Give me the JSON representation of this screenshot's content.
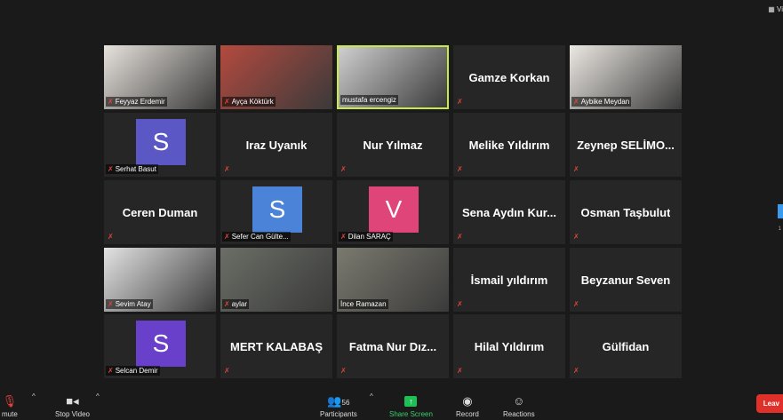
{
  "window": {
    "view_label": "Vi"
  },
  "tiles": [
    {
      "kind": "photo",
      "label": "Feyyaz Erdemir",
      "muted": true,
      "bg": "#2a2a2a",
      "photo_bg": "#e7e2dc"
    },
    {
      "kind": "photo",
      "label": "Ayça Köktürk",
      "muted": true,
      "bg": "#2a2a2a",
      "photo_bg": "#b44a3f"
    },
    {
      "kind": "photo",
      "label": "mustafa ercengiz",
      "muted": false,
      "active": true,
      "bg": "#2a2a2a",
      "photo_bg": "#cfcfcf"
    },
    {
      "kind": "name",
      "name": "Gamze Korkan",
      "muted": true
    },
    {
      "kind": "photo",
      "label": "Aybike Meydan",
      "muted": true,
      "bg": "#2a2a2a",
      "photo_bg": "#ece8e3"
    },
    {
      "kind": "avatar",
      "letter": "S",
      "label": "Serhat Basut",
      "muted": true,
      "color": "#5b57c5"
    },
    {
      "kind": "name",
      "name": "Iraz Uyanık",
      "muted": true
    },
    {
      "kind": "name",
      "name": "Nur Yılmaz",
      "muted": true
    },
    {
      "kind": "name",
      "name": "Melike Yıldırım",
      "muted": true
    },
    {
      "kind": "name",
      "name": "Zeynep SELİMO...",
      "muted": true
    },
    {
      "kind": "name",
      "name": "Ceren Duman",
      "muted": true
    },
    {
      "kind": "avatar",
      "letter": "S",
      "label": "Sefer Can Gülte...",
      "muted": true,
      "color": "#4a83d8"
    },
    {
      "kind": "avatar",
      "letter": "V",
      "label": "Dilan SARAÇ",
      "muted": true,
      "color": "#e0457a"
    },
    {
      "kind": "name",
      "name": "Sena Aydın Kur...",
      "muted": true
    },
    {
      "kind": "name",
      "name": "Osman Taşbulut",
      "muted": true
    },
    {
      "kind": "photo",
      "label": "Sevim Atay",
      "muted": true,
      "bg": "#2a2a2a",
      "photo_bg": "#e3e3e3"
    },
    {
      "kind": "photo",
      "label": "aylar",
      "muted": true,
      "bg": "#2a2a2a",
      "photo_bg": "#6b6e66"
    },
    {
      "kind": "photo",
      "label": "İnce Ramazan",
      "muted": false,
      "bg": "#2a2a2a",
      "photo_bg": "#7b7a6f"
    },
    {
      "kind": "name",
      "name": "İsmail yıldırım",
      "muted": true
    },
    {
      "kind": "name",
      "name": "Beyzanur Seven",
      "muted": true
    },
    {
      "kind": "avatar",
      "letter": "S",
      "label": "Selcan Demir",
      "muted": true,
      "color": "#6940c9"
    },
    {
      "kind": "name",
      "name": "MERT KALABAŞ",
      "muted": true
    },
    {
      "kind": "name",
      "name": "Fatma Nur Dız...",
      "muted": true
    },
    {
      "kind": "name",
      "name": "Hilal Yıldırım",
      "muted": true
    },
    {
      "kind": "name",
      "name": "Gülfidan",
      "muted": true
    }
  ],
  "toolbar": {
    "unmute": "mute",
    "stop_video": "Stop Video",
    "participants": "Participants",
    "participant_count": "56",
    "share_screen": "Share Screen",
    "record": "Record",
    "reactions": "Reactions",
    "leave": "Leav"
  },
  "side_page": "1"
}
